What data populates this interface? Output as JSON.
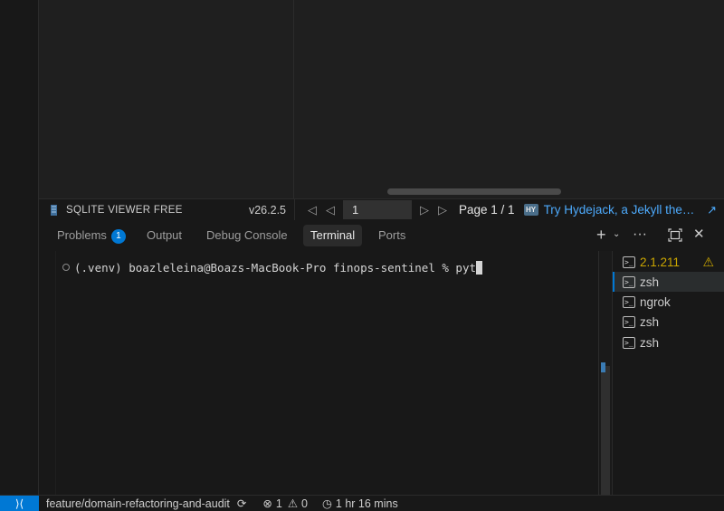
{
  "sqlite_viewer": {
    "title": "SQLITE VIEWER FREE",
    "version": "v26.2.5"
  },
  "pdf_toolbar": {
    "page_value": "1",
    "page_label": "Page 1 / 1",
    "hydejack_badge": "HY",
    "hydejack_text": "Try Hydejack, a Jekyll the…"
  },
  "panel": {
    "tabs": [
      {
        "label": "Problems",
        "badge": "1"
      },
      {
        "label": "Output"
      },
      {
        "label": "Debug Console"
      },
      {
        "label": "Terminal",
        "active": true
      },
      {
        "label": "Ports"
      }
    ],
    "icons": {
      "add": "plus-icon",
      "chevron": "chevron-down-icon",
      "more": "ellipsis-icon",
      "maximize": "maximize-icon",
      "close": "close-icon"
    }
  },
  "terminal": {
    "prompt_line": "(.venv) boazleleina@Boazs-MacBook-Pro finops-sentinel % pyt"
  },
  "terminal_list": [
    {
      "label": "2.1.211",
      "warning": true
    },
    {
      "label": "zsh",
      "selected": true
    },
    {
      "label": "ngrok"
    },
    {
      "label": "zsh"
    },
    {
      "label": "zsh"
    }
  ],
  "status_bar": {
    "branch": "feature/domain-refactoring-and-audit",
    "errors": "1",
    "warnings": "0",
    "time": "1 hr 16 mins"
  },
  "colors": {
    "accent": "#0078d4",
    "link": "#4daafc",
    "warning": "#cca700",
    "background": "#181818"
  }
}
